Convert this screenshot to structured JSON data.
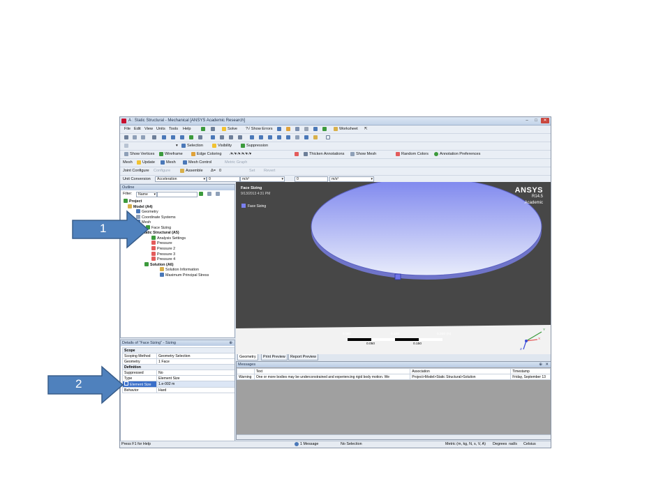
{
  "window": {
    "title": "A : Static Structural - Mechanical [ANSYS Academic Research]",
    "buttons": {
      "minimize": "–",
      "maximize": "□",
      "close": "✕"
    }
  },
  "menubar": {
    "items": [
      "File",
      "Edit",
      "View",
      "Units",
      "Tools",
      "Help"
    ],
    "solve": "Solve",
    "show_errors": "?√ Show Errors",
    "worksheet": "Worksheet"
  },
  "toolbar_selection": {
    "selection": "Selection",
    "visibility": "Visibility",
    "suppression": "Suppression"
  },
  "toolbar_display": {
    "show_vertices": "Show Vertices",
    "wireframe": "Wireframe",
    "edge_coloring": "Edge Coloring",
    "thicken_annotations": "Thicken Annotations",
    "show_mesh": "Show Mesh",
    "random_colors": "Random Colors",
    "annotation_preferences": "Annotation Preferences"
  },
  "toolbar_mesh": {
    "mesh_label": "Mesh",
    "update": "Update",
    "mesh": "Mesh",
    "mesh_control": "Mesh Control",
    "metric_graph": "Metric Graph"
  },
  "toolbar_joint": {
    "joint_configure": "Joint Configure",
    "configure": "Configure",
    "assemble": "Assemble",
    "delta": "Δ=",
    "delta_value": "0",
    "set": "Set",
    "revert": "Revert"
  },
  "unit_conversion": {
    "label": "Unit Conversion",
    "quantity": "Acceleration",
    "value1": "0",
    "unit1": "m/s²",
    "value2": "0",
    "unit2": "m/s²"
  },
  "outline": {
    "header": "Outline",
    "filter_label": "Filter:",
    "filter_value": "Name",
    "tree": [
      {
        "label": "Project",
        "bold": true
      },
      {
        "label": "Model (A4)",
        "bold": true
      },
      {
        "label": "Geometry"
      },
      {
        "label": "Coordinate Systems"
      },
      {
        "label": "Mesh"
      },
      {
        "label": "Face Sizing"
      },
      {
        "label": "Static Structural (A5)",
        "bold": true
      },
      {
        "label": "Analysis Settings"
      },
      {
        "label": "Pressure"
      },
      {
        "label": "Pressure 2"
      },
      {
        "label": "Pressure 3"
      },
      {
        "label": "Pressure 4"
      },
      {
        "label": "Solution (A6)",
        "bold": true
      },
      {
        "label": "Solution Information"
      },
      {
        "label": "Maximum Principal Stress"
      }
    ]
  },
  "details": {
    "header": "Details of \"Face Sizing\" - Sizing",
    "pin": "⊕",
    "scope_group": "Scope",
    "scoping_method_key": "Scoping Method",
    "scoping_method_val": "Geometry Selection",
    "geometry_key": "Geometry",
    "geometry_val": "1 Face",
    "definition_group": "Definition",
    "suppressed_key": "Suppressed",
    "suppressed_val": "No",
    "type_key": "Type",
    "type_val": "Element Size",
    "element_size_key": "Element Size",
    "element_size_val": "1.e-002 m",
    "behavior_key": "Behavior",
    "behavior_val": "Hard"
  },
  "viewport": {
    "title": "Face Sizing",
    "date": "9/13/2013 4:31 PM",
    "legend": "Face Sizing",
    "brand": "ANSYS",
    "release": "R14.5",
    "edition": "Academic",
    "scale_top_left": "0.000",
    "scale_top_mid": "0.100",
    "scale_top_right": "0.200 (m)",
    "scale_bottom_left": "0.050",
    "scale_bottom_right": "0.150",
    "triad_y": "Y",
    "triad_x": "X",
    "triad_z": "Z",
    "colors": {
      "body_top": "#7d86ee",
      "body_bottom": "#e8ecfb",
      "background": "#474747"
    }
  },
  "view_tabs": [
    "Geometry",
    "Print Preview",
    "Report Preview"
  ],
  "messages": {
    "header": "Messages",
    "pin": "⊕",
    "close": "✕",
    "columns": [
      "",
      "Text",
      "Association",
      "Timestamp"
    ],
    "rows": [
      [
        "Warning",
        "One or more bodies may be underconstrained and experiencing rigid body motion. We",
        "Project>Model>Static Structural>Solution",
        "Friday, September 13"
      ]
    ]
  },
  "statusbar": {
    "help": "Press F1 for Help",
    "messages": "1 Message",
    "selection": "No Selection",
    "units": "Metric (m, kg, N, s, V, A)",
    "angle": "Degrees",
    "rate": "rad/s",
    "temp": "Celsius"
  },
  "callouts": [
    {
      "number": "1",
      "color": "#4f81bd"
    },
    {
      "number": "2",
      "color": "#4f81bd"
    }
  ]
}
